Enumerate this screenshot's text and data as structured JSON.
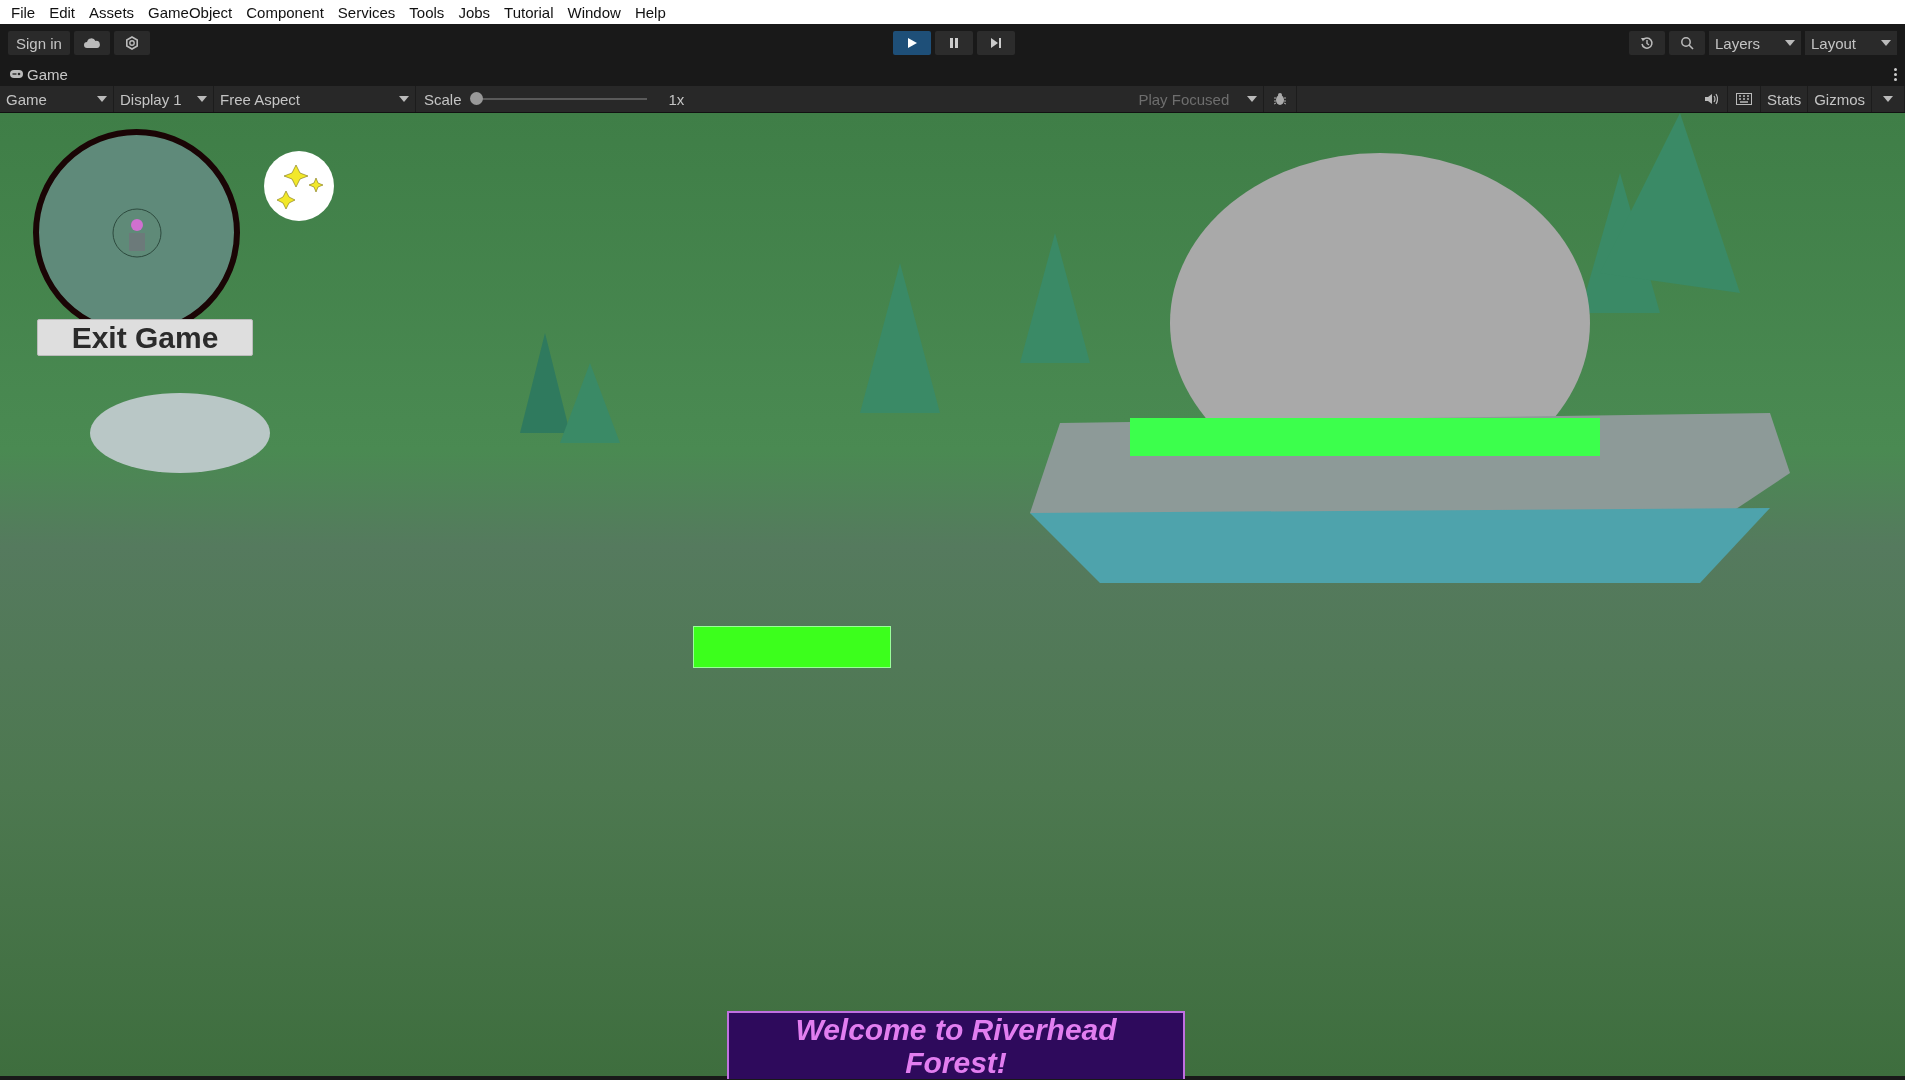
{
  "menu_bar": [
    "File",
    "Edit",
    "Assets",
    "GameObject",
    "Component",
    "Services",
    "Tools",
    "Jobs",
    "Tutorial",
    "Window",
    "Help"
  ],
  "toolbar": {
    "sign_in": "Sign in",
    "playback": [
      {
        "kind": "play",
        "selected": true
      },
      {
        "kind": "pause",
        "selected": false
      },
      {
        "kind": "step",
        "selected": false
      }
    ],
    "layers": "Layers",
    "layout": "Layout"
  },
  "tab": {
    "title": "Game"
  },
  "game_toolbar": {
    "view": "Game",
    "display": "Display 1",
    "aspect": "Free Aspect",
    "scale_label": "Scale",
    "scale": {
      "level": 0
    },
    "scale_reading": "1x",
    "play_mode": "Play Focused",
    "stats": "Stats",
    "gizmos": "Gizmos"
  },
  "hud": {
    "exit_button": "Exit Game",
    "banner": [
      "Welcome to Riverhead",
      "Forest!"
    ]
  }
}
